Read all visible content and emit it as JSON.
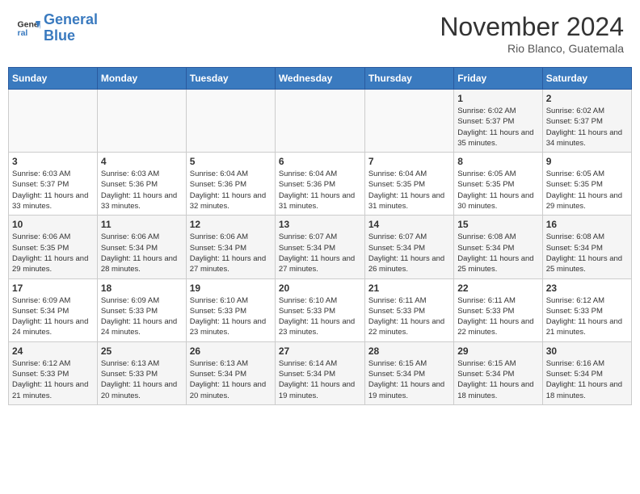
{
  "header": {
    "logo_line1": "General",
    "logo_line2": "Blue",
    "month_title": "November 2024",
    "location": "Rio Blanco, Guatemala"
  },
  "weekdays": [
    "Sunday",
    "Monday",
    "Tuesday",
    "Wednesday",
    "Thursday",
    "Friday",
    "Saturday"
  ],
  "weeks": [
    [
      {
        "day": "",
        "info": ""
      },
      {
        "day": "",
        "info": ""
      },
      {
        "day": "",
        "info": ""
      },
      {
        "day": "",
        "info": ""
      },
      {
        "day": "",
        "info": ""
      },
      {
        "day": "1",
        "info": "Sunrise: 6:02 AM\nSunset: 5:37 PM\nDaylight: 11 hours and 35 minutes."
      },
      {
        "day": "2",
        "info": "Sunrise: 6:02 AM\nSunset: 5:37 PM\nDaylight: 11 hours and 34 minutes."
      }
    ],
    [
      {
        "day": "3",
        "info": "Sunrise: 6:03 AM\nSunset: 5:37 PM\nDaylight: 11 hours and 33 minutes."
      },
      {
        "day": "4",
        "info": "Sunrise: 6:03 AM\nSunset: 5:36 PM\nDaylight: 11 hours and 33 minutes."
      },
      {
        "day": "5",
        "info": "Sunrise: 6:04 AM\nSunset: 5:36 PM\nDaylight: 11 hours and 32 minutes."
      },
      {
        "day": "6",
        "info": "Sunrise: 6:04 AM\nSunset: 5:36 PM\nDaylight: 11 hours and 31 minutes."
      },
      {
        "day": "7",
        "info": "Sunrise: 6:04 AM\nSunset: 5:35 PM\nDaylight: 11 hours and 31 minutes."
      },
      {
        "day": "8",
        "info": "Sunrise: 6:05 AM\nSunset: 5:35 PM\nDaylight: 11 hours and 30 minutes."
      },
      {
        "day": "9",
        "info": "Sunrise: 6:05 AM\nSunset: 5:35 PM\nDaylight: 11 hours and 29 minutes."
      }
    ],
    [
      {
        "day": "10",
        "info": "Sunrise: 6:06 AM\nSunset: 5:35 PM\nDaylight: 11 hours and 29 minutes."
      },
      {
        "day": "11",
        "info": "Sunrise: 6:06 AM\nSunset: 5:34 PM\nDaylight: 11 hours and 28 minutes."
      },
      {
        "day": "12",
        "info": "Sunrise: 6:06 AM\nSunset: 5:34 PM\nDaylight: 11 hours and 27 minutes."
      },
      {
        "day": "13",
        "info": "Sunrise: 6:07 AM\nSunset: 5:34 PM\nDaylight: 11 hours and 27 minutes."
      },
      {
        "day": "14",
        "info": "Sunrise: 6:07 AM\nSunset: 5:34 PM\nDaylight: 11 hours and 26 minutes."
      },
      {
        "day": "15",
        "info": "Sunrise: 6:08 AM\nSunset: 5:34 PM\nDaylight: 11 hours and 25 minutes."
      },
      {
        "day": "16",
        "info": "Sunrise: 6:08 AM\nSunset: 5:34 PM\nDaylight: 11 hours and 25 minutes."
      }
    ],
    [
      {
        "day": "17",
        "info": "Sunrise: 6:09 AM\nSunset: 5:34 PM\nDaylight: 11 hours and 24 minutes."
      },
      {
        "day": "18",
        "info": "Sunrise: 6:09 AM\nSunset: 5:33 PM\nDaylight: 11 hours and 24 minutes."
      },
      {
        "day": "19",
        "info": "Sunrise: 6:10 AM\nSunset: 5:33 PM\nDaylight: 11 hours and 23 minutes."
      },
      {
        "day": "20",
        "info": "Sunrise: 6:10 AM\nSunset: 5:33 PM\nDaylight: 11 hours and 23 minutes."
      },
      {
        "day": "21",
        "info": "Sunrise: 6:11 AM\nSunset: 5:33 PM\nDaylight: 11 hours and 22 minutes."
      },
      {
        "day": "22",
        "info": "Sunrise: 6:11 AM\nSunset: 5:33 PM\nDaylight: 11 hours and 22 minutes."
      },
      {
        "day": "23",
        "info": "Sunrise: 6:12 AM\nSunset: 5:33 PM\nDaylight: 11 hours and 21 minutes."
      }
    ],
    [
      {
        "day": "24",
        "info": "Sunrise: 6:12 AM\nSunset: 5:33 PM\nDaylight: 11 hours and 21 minutes."
      },
      {
        "day": "25",
        "info": "Sunrise: 6:13 AM\nSunset: 5:33 PM\nDaylight: 11 hours and 20 minutes."
      },
      {
        "day": "26",
        "info": "Sunrise: 6:13 AM\nSunset: 5:34 PM\nDaylight: 11 hours and 20 minutes."
      },
      {
        "day": "27",
        "info": "Sunrise: 6:14 AM\nSunset: 5:34 PM\nDaylight: 11 hours and 19 minutes."
      },
      {
        "day": "28",
        "info": "Sunrise: 6:15 AM\nSunset: 5:34 PM\nDaylight: 11 hours and 19 minutes."
      },
      {
        "day": "29",
        "info": "Sunrise: 6:15 AM\nSunset: 5:34 PM\nDaylight: 11 hours and 18 minutes."
      },
      {
        "day": "30",
        "info": "Sunrise: 6:16 AM\nSunset: 5:34 PM\nDaylight: 11 hours and 18 minutes."
      }
    ]
  ]
}
